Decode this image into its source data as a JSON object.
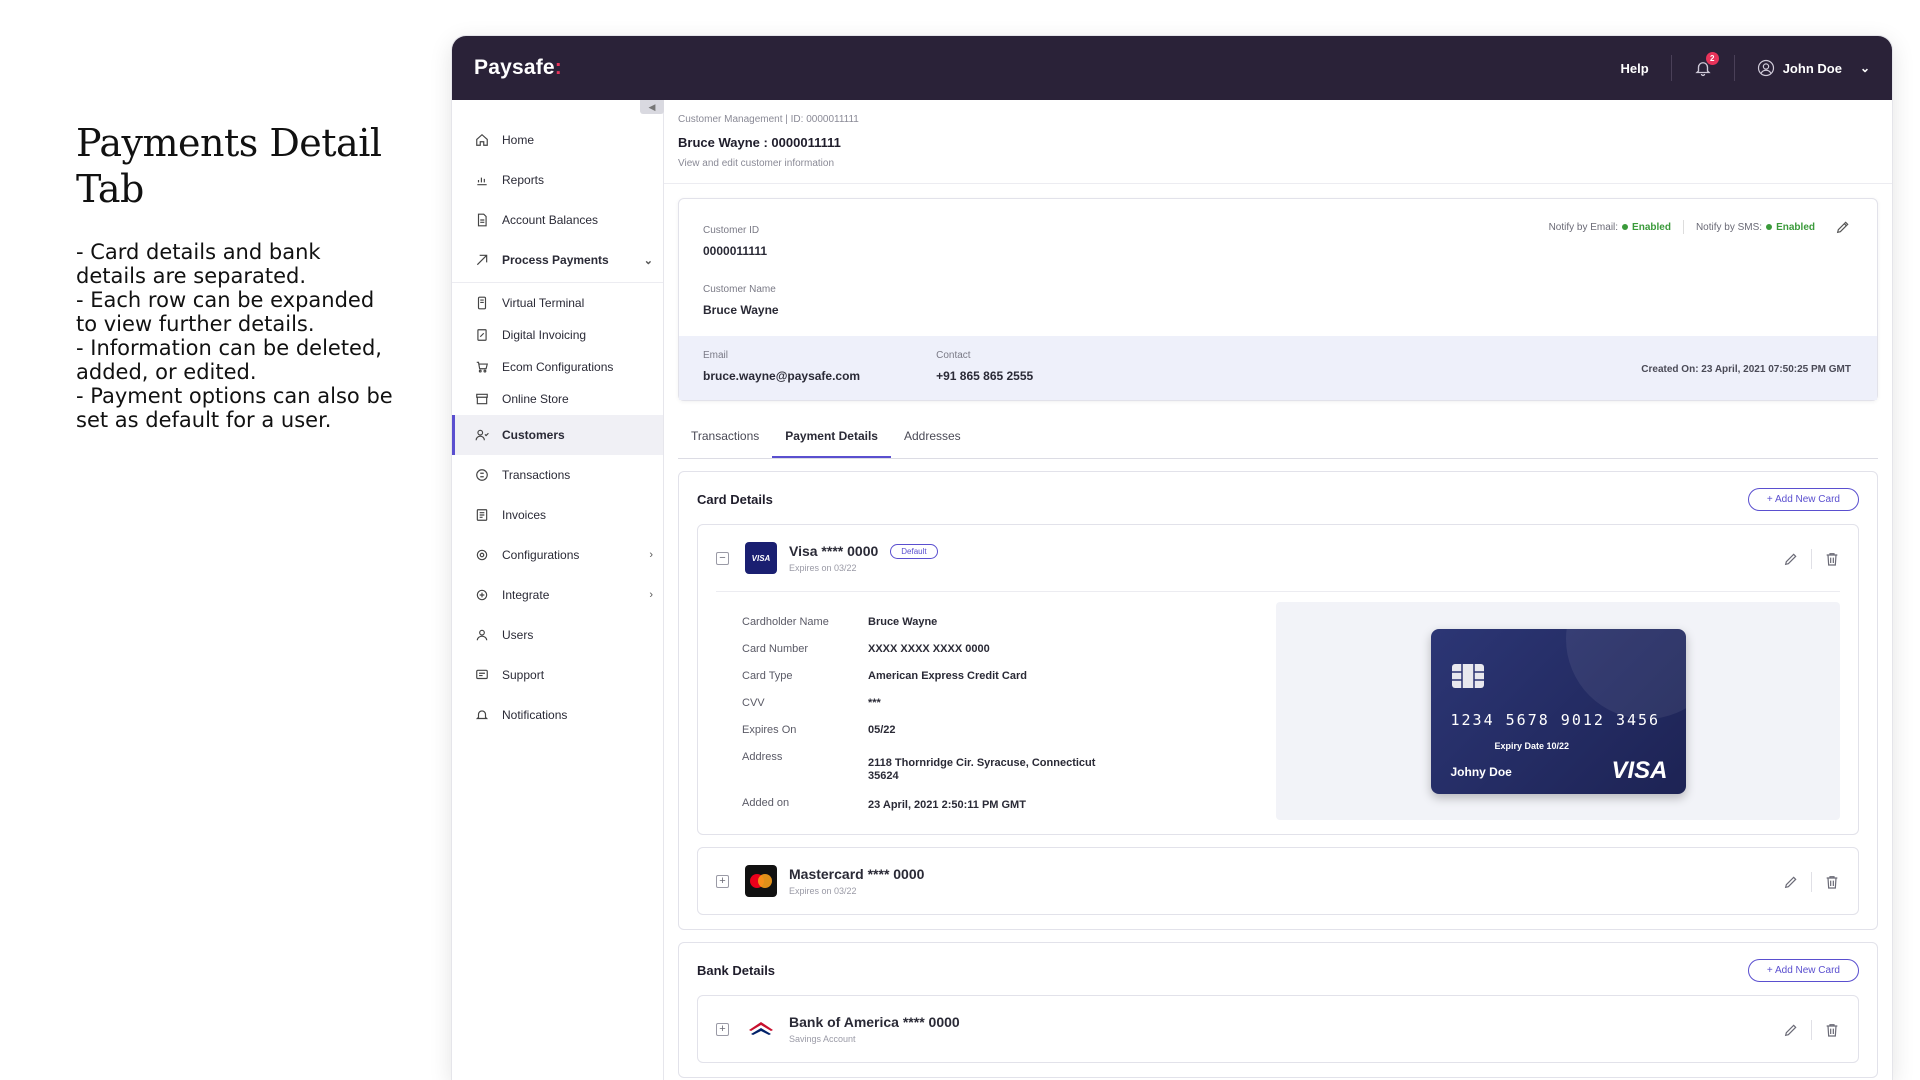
{
  "note": {
    "title": "Payments Detail Tab",
    "lines": [
      "- Card details and bank details are separated.",
      "- Each row can be expanded to view further details.",
      "- Information can be deleted, added, or edited.",
      "- Payment options can also be set as default for a user."
    ]
  },
  "topbar": {
    "logo": "Paysafe",
    "logo_dot": ":",
    "help": "Help",
    "notification_count": "2",
    "user_name": "John Doe"
  },
  "sidebar": {
    "items": [
      {
        "label": "Home",
        "icon": "home-icon"
      },
      {
        "label": "Reports",
        "icon": "chart-icon"
      },
      {
        "label": "Account Balances",
        "icon": "document-icon"
      },
      {
        "label": "Process Payments",
        "icon": "payment-icon"
      },
      {
        "label": "Virtual Terminal",
        "icon": "terminal-icon"
      },
      {
        "label": "Digital Invoicing",
        "icon": "invoice-icon"
      },
      {
        "label": "Ecom Configurations",
        "icon": "cart-icon"
      },
      {
        "label": "Online Store",
        "icon": "store-icon"
      },
      {
        "label": "Customers",
        "icon": "customers-icon"
      },
      {
        "label": "Transactions",
        "icon": "transactions-icon"
      },
      {
        "label": "Invoices",
        "icon": "invoices-icon"
      },
      {
        "label": "Configurations",
        "icon": "gear-icon"
      },
      {
        "label": "Integrate",
        "icon": "integrate-icon"
      },
      {
        "label": "Users",
        "icon": "users-icon"
      },
      {
        "label": "Support",
        "icon": "support-icon"
      },
      {
        "label": "Notifications",
        "icon": "bell-icon"
      }
    ]
  },
  "header": {
    "breadcrumb": "Customer Management  |  ID: 0000011111",
    "title": "Bruce Wayne : 0000011111",
    "subtitle": "View and edit customer information"
  },
  "customer": {
    "id_label": "Customer ID",
    "id_value": "0000011111",
    "name_label": "Customer Name",
    "name_value": "Bruce Wayne",
    "notify_email_label": "Notify by Email:",
    "notify_email_value": "Enabled",
    "notify_sms_label": "Notify by SMS:",
    "notify_sms_value": "Enabled",
    "email_label": "Email",
    "email_value": "bruce.wayne@paysafe.com",
    "contact_label": "Contact",
    "contact_value": "+91 865 865 2555",
    "created_on": "Created On: 23 April, 2021 07:50:25 PM GMT"
  },
  "tabs": [
    "Transactions",
    "Payment Details",
    "Addresses"
  ],
  "card_section": {
    "title": "Card Details",
    "add_label": "+ Add New Card",
    "cards": [
      {
        "name": "Visa **** 0000",
        "expires": "Expires on 03/22",
        "badge": "Default",
        "brand_text": "VISA",
        "details": [
          {
            "k": "Cardholder Name",
            "v": "Bruce Wayne"
          },
          {
            "k": "Card Number",
            "v": "XXXX XXXX XXXX 0000"
          },
          {
            "k": "Card Type",
            "v": "American Express Credit Card"
          },
          {
            "k": "CVV",
            "v": "***"
          },
          {
            "k": "Expires On",
            "v": "05/22"
          },
          {
            "k": "Address",
            "v": "2118 Thornridge Cir. Syracuse, Connecticut 35624"
          },
          {
            "k": "Added on",
            "v": "23 April, 2021 2:50:11 PM GMT"
          }
        ],
        "visual": {
          "number": "1234  5678  9012  3456",
          "expiry": "Expiry Date 10/22",
          "holder": "Johny Doe",
          "logo": "VISA"
        }
      },
      {
        "name": "Mastercard **** 0000",
        "expires": "Expires on 03/22"
      }
    ]
  },
  "bank_section": {
    "title": "Bank Details",
    "add_label": "+ Add New Card",
    "banks": [
      {
        "name": "Bank of America **** 0000",
        "type": "Savings Account"
      }
    ]
  },
  "colors": {
    "topbar": "#2a2238",
    "accent": "#5a4fcf",
    "enabled": "#3a9a3a",
    "brand_dot": "#e8335a"
  }
}
